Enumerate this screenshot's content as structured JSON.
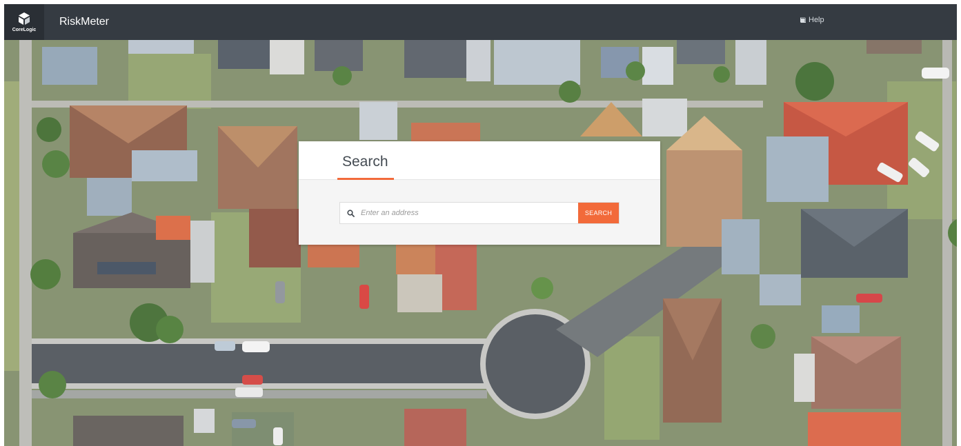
{
  "header": {
    "logo_text": "CoreLogic",
    "app_title": "RiskMeter",
    "help_label": "Help"
  },
  "search": {
    "title": "Search",
    "placeholder": "Enter an address",
    "button_label": "SEARCH"
  },
  "colors": {
    "topbar": "#353b42",
    "accent": "#f26a3a"
  },
  "icons": {
    "logo": "corelogic-logo-icon",
    "help": "book-icon",
    "search": "search-icon"
  }
}
